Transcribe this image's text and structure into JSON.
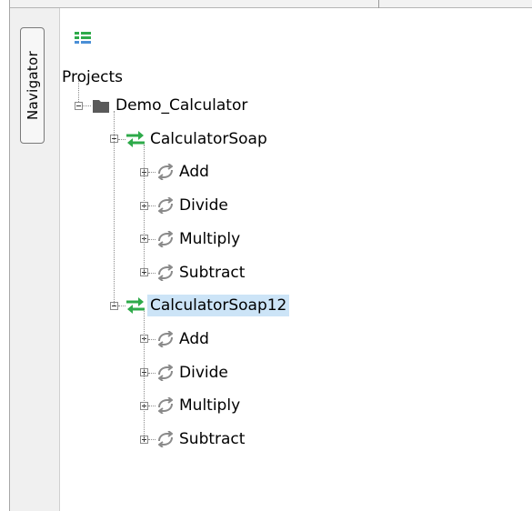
{
  "navigator": {
    "tab_label": "Navigator"
  },
  "toolbar": {
    "view_icon": "list-view-icon"
  },
  "tree": {
    "root_label": "Projects",
    "project": {
      "label": "Demo_Calculator",
      "icon": "folder-icon"
    },
    "interfaces": [
      {
        "label": "CalculatorSoap",
        "icon": "soap-interface-icon",
        "selected": false,
        "operations": [
          "Add",
          "Divide",
          "Multiply",
          "Subtract"
        ]
      },
      {
        "label": "CalculatorSoap12",
        "icon": "soap-interface-icon",
        "selected": true,
        "operations": [
          "Add",
          "Divide",
          "Multiply",
          "Subtract"
        ]
      }
    ],
    "operation_icon": "operation-cycle-icon",
    "colors": {
      "selection": "#cce4f7",
      "interface_icon": "#2eaa4a",
      "folder_icon": "#5a5a5a",
      "operation_icon": "#8a8a8a",
      "toolbar_icon": "#2eaa4a"
    }
  }
}
